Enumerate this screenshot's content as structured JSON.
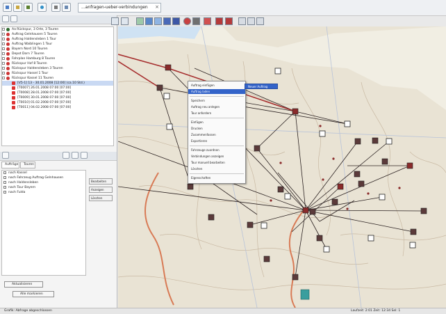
{
  "tab": {
    "title": "...anfragen-ueber-verbindungen"
  },
  "tree": {
    "items": [
      {
        "label": "Aa Rückspur, 3 Orte, 3 Touren",
        "color": "#2d6a2d"
      },
      {
        "label": "Auftrag Gelnhausen 5 Touren",
        "color": "#c33"
      },
      {
        "label": "Auftrag Haldensleben 1 Tour",
        "color": "#c33"
      },
      {
        "label": "Auftrag Waiblingen 1 Tour",
        "color": "#c33"
      },
      {
        "label": "Bayern Nord 10 Touren",
        "color": "#c33"
      },
      {
        "label": "Depot Dorn 7 Touren",
        "color": "#c33"
      },
      {
        "label": "Fahrplan Hamburg 8 Touren",
        "color": "#c33"
      },
      {
        "label": "Rückspur Hof 8 Touren",
        "color": "#c33"
      },
      {
        "label": "Rückspur Haldensleben 3 Touren",
        "color": "#c33"
      },
      {
        "label": "Rückspur Hassel 1 Tour",
        "color": "#c33"
      },
      {
        "label": "Rückspur Kassel 11 Touren",
        "color": "#c33"
      }
    ],
    "subitems": [
      "[V5-1] 13 - 30.01.2008 [12:00] (ca.10 Std.)",
      "[T0007] 26.01.2008 07:00 [07:00]",
      "[T0008] 28.01.2008 07:00 [07:00]",
      "[T0009] 30.01.2008 07:00 [07:00]",
      "[T0010] 01.02.2008 07:00 [07:00]",
      "[T0011] 04.02.2008 07:00 [07:00]"
    ]
  },
  "lower": {
    "tabs": [
      "Aufträge",
      "Touren"
    ],
    "list": [
      "nach Kassel",
      "nach Fahrzeug Auftrag Gelnhausen",
      "nach Haldensleben",
      "nach Tour Bayern",
      "nach Fulda"
    ],
    "side_buttons": [
      "Bearbeiten",
      "Anzeigen",
      "Löschen"
    ],
    "bottom_buttons": [
      "Aktualisieren",
      "Alle markieren"
    ]
  },
  "context_menu": {
    "items": [
      {
        "label": "Auftrag einfügen",
        "highlight": false
      },
      {
        "label": "Auftrag laden",
        "highlight": true
      },
      {
        "label": "Speichern",
        "highlight": false
      },
      {
        "label": "Auftrag neu anlegen",
        "highlight": false
      },
      {
        "label": "Tour anfordern",
        "highlight": false
      },
      {
        "label": "Einfügen",
        "highlight": false
      },
      {
        "label": "Drucken",
        "highlight": false
      },
      {
        "label": "Zusammenfassen",
        "highlight": false
      },
      {
        "label": "Exportieren",
        "highlight": false
      },
      {
        "label": "Fahrzeuge zuordnen",
        "highlight": false
      },
      {
        "label": "Verbindungen anzeigen",
        "highlight": false
      },
      {
        "label": "Tour manuell bearbeiten",
        "highlight": false
      },
      {
        "label": "Löschen",
        "highlight": false
      },
      {
        "label": "Eigenschaften",
        "highlight": false
      }
    ],
    "submenu": "Neuer Auftrag"
  },
  "statusbar": {
    "left": "Grafik: Abfrage abgeschlossen",
    "right": "Laufzeit: 2:01 Zeit: 12:34 Sel: 1"
  }
}
